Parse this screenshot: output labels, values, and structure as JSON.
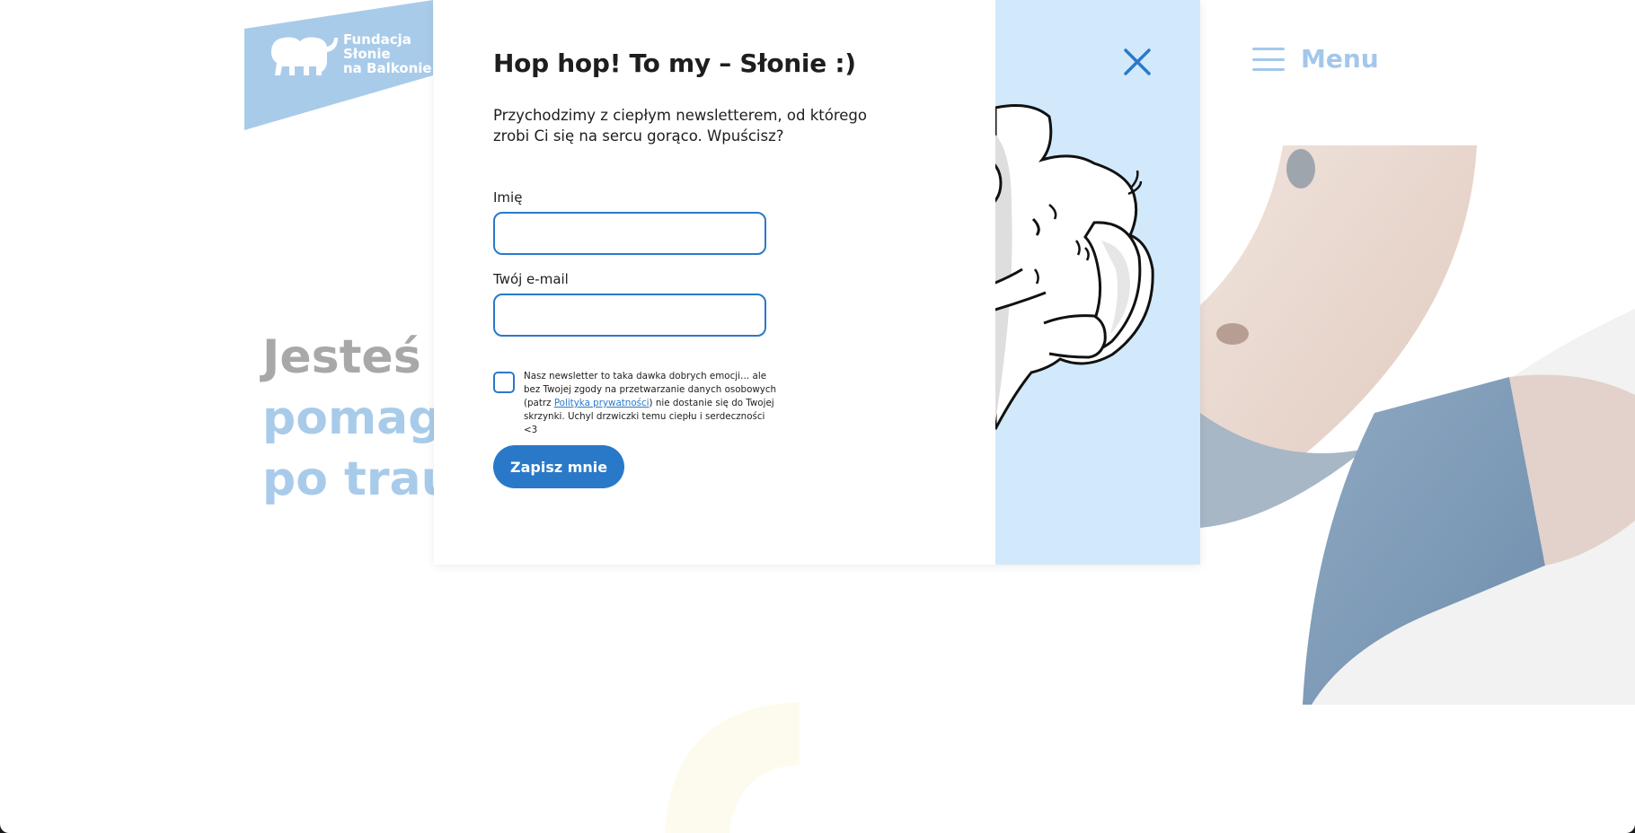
{
  "site": {
    "logo_lines": [
      "Fundacja",
      "Słonie",
      "na Balkonie"
    ],
    "menu_label": "Menu",
    "hero": {
      "line1": "Jesteś",
      "line2": "pomag",
      "line3": "po trau"
    },
    "colors": {
      "logo_bg": "#a9cbea",
      "menu": "#a3c7ea",
      "hero_gray": "#a8a8a8",
      "hero_blue": "#a9cbea"
    }
  },
  "modal": {
    "title": "Hop hop! To my – Słonie :)",
    "lead": "Przychodzimy z ciepłym newsletterem, od którego zrobi Ci się na sercu gorąco. Wpuścisz?",
    "name_label": "Imię",
    "name_value": "",
    "email_label": "Twój e-mail",
    "email_value": "",
    "consent": {
      "checked": false,
      "text_before": "Nasz newsletter to taka dawka dobrych emocji… ale bez Twojej zgody na przetwarzanie danych osobowych (patrz ",
      "link_text": "Polityka prywatności",
      "text_after": ") nie dostanie się do Twojej skrzynki. Uchyl drzwiczki temu ciepłu i serdeczności <3"
    },
    "submit_label": "Zapisz mnie",
    "icons": {
      "close": "close-icon",
      "elephant": "elephant-illustration"
    },
    "colors": {
      "accent": "#2a79c9",
      "side_panel": "#d1e9fb"
    }
  }
}
